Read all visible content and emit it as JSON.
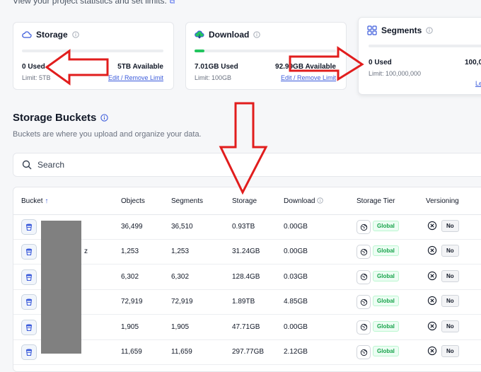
{
  "header": {
    "subtitle": "View your project statistics and set limits."
  },
  "cards": {
    "storage": {
      "title": "Storage",
      "used": "0 Used",
      "available": "5TB Available",
      "limit": "Limit: 5TB",
      "edit": "Edit / Remove Limit",
      "progress": 0
    },
    "download": {
      "title": "Download",
      "used": "7.01GB Used",
      "available": "92.99GB Available",
      "limit": "Limit: 100GB",
      "edit": "Edit / Remove Limit",
      "progress": 0.07
    },
    "segments": {
      "title": "Segments",
      "used": "0 Used",
      "available": "100,0",
      "limit": "Limit: 100,000,000",
      "edit": "Le",
      "progress": 0
    }
  },
  "buckets": {
    "title": "Storage Buckets",
    "subtitle": "Buckets are where you upload and organize your data.",
    "search_placeholder": "Search",
    "columns": [
      "Bucket",
      "Objects",
      "Segments",
      "Storage",
      "Download",
      "Storage Tier",
      "Versioning"
    ],
    "rows": [
      {
        "name": "",
        "objects": "36,499",
        "segments": "36,510",
        "storage": "0.93TB",
        "download": "0.00GB",
        "tier": "Global",
        "versioning": "No"
      },
      {
        "name": "z",
        "objects": "1,253",
        "segments": "1,253",
        "storage": "31.24GB",
        "download": "0.00GB",
        "tier": "Global",
        "versioning": "No"
      },
      {
        "name": "",
        "objects": "6,302",
        "segments": "6,302",
        "storage": "128.4GB",
        "download": "0.03GB",
        "tier": "Global",
        "versioning": "No"
      },
      {
        "name": "",
        "objects": "72,919",
        "segments": "72,919",
        "storage": "1.89TB",
        "download": "4.85GB",
        "tier": "Global",
        "versioning": "No"
      },
      {
        "name": "",
        "objects": "1,905",
        "segments": "1,905",
        "storage": "47.71GB",
        "download": "0.00GB",
        "tier": "Global",
        "versioning": "No"
      },
      {
        "name": "",
        "objects": "11,659",
        "segments": "11,659",
        "storage": "297.77GB",
        "download": "2.12GB",
        "tier": "Global",
        "versioning": "No"
      }
    ]
  },
  "colors": {
    "accent": "#3b5bdb",
    "progress": "#22c55e",
    "arrow": "#e11d1d",
    "redaction": "#808080"
  }
}
